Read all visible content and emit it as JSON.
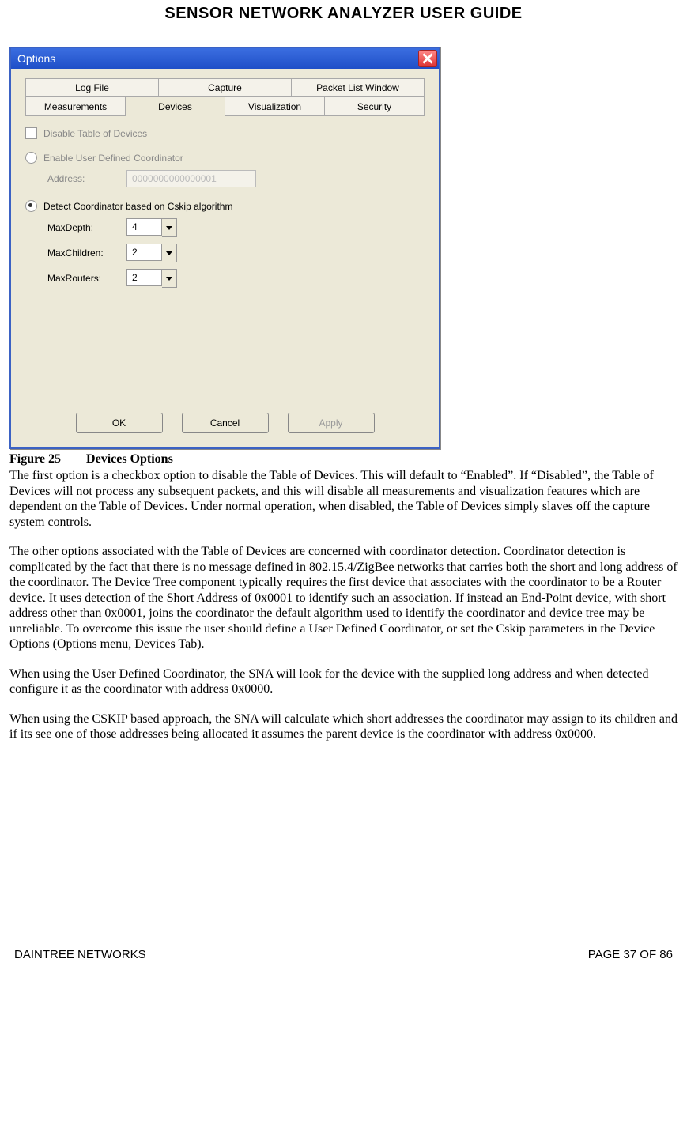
{
  "doc_title": "SENSOR NETWORK ANALYZER USER GUIDE",
  "dialog": {
    "title": "Options",
    "tabs_row1": [
      "Log File",
      "Capture",
      "Packet List Window"
    ],
    "tabs_row2": [
      "Measurements",
      "Devices",
      "Visualization",
      "Security"
    ],
    "active_tab": "Devices",
    "disable_table_label": "Disable Table of Devices",
    "enable_user_coord_label": "Enable User Defined Coordinator",
    "address_label": "Address:",
    "address_value": "0000000000000001",
    "detect_cskip_label": "Detect Coordinator based on Cskip algorithm",
    "max_depth_label": "MaxDepth:",
    "max_depth_value": "4",
    "max_children_label": "MaxChildren:",
    "max_children_value": "2",
    "max_routers_label": "MaxRouters:",
    "max_routers_value": "2",
    "ok_label": "OK",
    "cancel_label": "Cancel",
    "apply_label": "Apply"
  },
  "caption_label": "Figure 25",
  "caption_title": "Devices Options",
  "para1": "The first option is a checkbox option to disable the Table of Devices. This will default to “Enabled”. If “Disabled”, the Table of Devices will not process any subsequent packets, and this will disable all measurements and visualization features which are dependent on the Table of Devices. Under normal operation, when disabled, the Table of Devices simply slaves off the capture system controls.",
  "para2": "The other options associated with the Table of Devices are concerned with coordinator detection. Coordinator detection is complicated by the fact that there is no message defined in 802.15.4/ZigBee networks that carries both the short and long address of the coordinator. The Device Tree component typically requires the first device that associates with the coordinator to be a Router device. It uses detection of the Short Address of 0x0001 to identify such an association. If instead an End-Point device, with short address other than 0x0001, joins the coordinator the default algorithm used to identify the coordinator and device tree may be unreliable. To overcome this issue the user should define a User Defined Coordinator, or set the Cskip parameters in the Device Options (Options menu, Devices Tab).",
  "para3": "When using the User Defined Coordinator, the SNA will look for the device with the supplied long address and when detected configure it as the coordinator with address 0x0000.",
  "para4": "When using the CSKIP based approach, the SNA will calculate which short addresses the coordinator may assign to its children and if its see one of those addresses being allocated it assumes the parent device is the coordinator with address 0x0000.",
  "footer_left": "DAINTREE NETWORKS",
  "footer_right": "PAGE 37 OF 86"
}
